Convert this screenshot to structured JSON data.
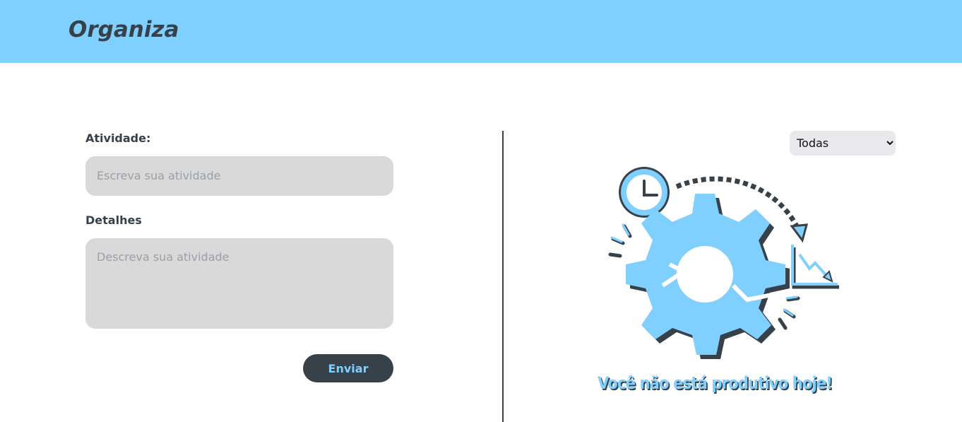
{
  "header": {
    "brand": "Organiza"
  },
  "form": {
    "activity_label": "Atividade:",
    "activity_placeholder": "Escreva sua atividade",
    "activity_value": "",
    "details_label": "Detalhes",
    "details_placeholder": "Descreva sua atividade",
    "details_value": "",
    "submit_label": "Enviar"
  },
  "filter": {
    "selected": "Todas",
    "options": [
      "Todas"
    ]
  },
  "empty_state": {
    "illustration_icon": "gear-clock-icon",
    "message": "Você não está produtivo hoje!"
  },
  "colors": {
    "primary": "#7fcfff",
    "dark": "#37414a",
    "field": "#d9d9d9"
  }
}
